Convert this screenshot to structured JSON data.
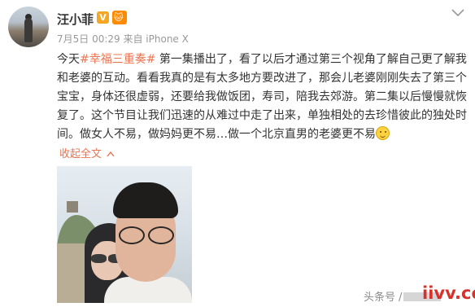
{
  "post": {
    "username": "汪小菲",
    "verified_badge": "V",
    "vip_badge": "🐱",
    "meta": "7月5日 00:29 来自 iPhone X",
    "text_before_topic": "今天",
    "topic": "#幸福三重奏#",
    "text_after_topic": " 第一集播出了，看了以后才通过第三个视角了解自己更了解我和老婆的互动。看看我真的是有太多地方要改进了，那会儿老婆刚刚失去了第三个宝宝，身体还很虚弱，还要给我做饭团，寿司，陪我去郊游。第二集以后慢慢就恢复了。这个节目让我们迅速的从难过中走了出来，单独相处的去珍惜彼此的独处时间。做女人不易，做妈妈更不易…做一个北京直男的老婆更不易",
    "emoji_name": "smile-emoji",
    "collapse_label": "收起全文",
    "collapse_arrow": "^",
    "photo_alt": "selfie-photo"
  },
  "icons": {
    "menu_chevron": "chevron-down-icon"
  },
  "watermark": {
    "source_prefix": "头条号",
    "source_slash": "/",
    "site_mark": "iivv.cc"
  },
  "colors": {
    "topic": "#eb7350",
    "meta": "#999999",
    "site_mark": "#d8302a"
  }
}
